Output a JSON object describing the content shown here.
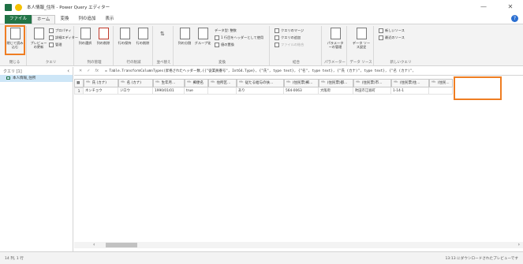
{
  "window": {
    "title": "本人情報_住所 - Power Query エディター",
    "minimize": "—",
    "close": "✕"
  },
  "tabs": [
    "ファイル",
    "ホーム",
    "変換",
    "列の追加",
    "表示"
  ],
  "ribbon": {
    "close_load": "閉じて読み込む",
    "preview_refresh": "プレビューの更新",
    "properties": "プロパティ",
    "adv_editor": "詳細エディター",
    "manage": "管理",
    "choose_cols": "列の選択",
    "remove_cols": "列の削除",
    "keep_rows": "行の保持",
    "remove_rows": "行の削除",
    "split_col": "列の分割",
    "group_by": "グループ化",
    "data_type": "データ型: 整数",
    "first_row_header": "1 行目をヘッダーとして使用",
    "replace_values": "値の置換",
    "merge_queries": "クエリのマージ",
    "append_queries": "クエリの追加",
    "combine_files": "ファイルの結合",
    "parameters": "パラメーターの管理",
    "data_source": "データ ソース設定",
    "new_source": "新しいソース",
    "recent_source": "最近のソース",
    "group_labels": {
      "close": "閉じる",
      "query": "クエリ",
      "manage_cols": "列の管理",
      "reduce_rows": "行の削減",
      "sort": "並べ替え",
      "transform": "変換",
      "combine": "結合",
      "params": "パラメーター",
      "datasource": "データ ソース",
      "newquery": "新しいクエリ"
    }
  },
  "queries": {
    "header": "クエリ [1]",
    "collapse": "‹",
    "items": [
      "本人情報_住所"
    ]
  },
  "formula": {
    "fx": "fx",
    "text": "= Table.TransformColumnTypes(昇格されたヘッダー数,{{\"従業員番号\", Int64.Type}, {\"氏\", type text}, {\"名\", type text}, {\"氏 (カナ)\", type text}, {\"名 (カナ)\","
  },
  "grid": {
    "columns": [
      "氏 (カナ)",
      "名 (カナ)",
      "生年月...",
      "郵便名",
      "住所区...",
      "従たる給与の扶...",
      "(住民票)郵...",
      "(住民票)都...",
      "(住民票)市...",
      "(住民票)住...",
      "(住民..."
    ],
    "rows": [
      {
        "num": "1",
        "cells": [
          "ネンチョウ",
          "ジロウ",
          "1990/01/01",
          "true",
          "",
          "あり",
          "564-0063",
          "大阪府",
          "吹田市江坂町",
          "1-14-1",
          ""
        ]
      }
    ]
  },
  "status": {
    "left": "14 列, 1 行",
    "right": "13:13 にダウンロードされたプレビューです"
  }
}
